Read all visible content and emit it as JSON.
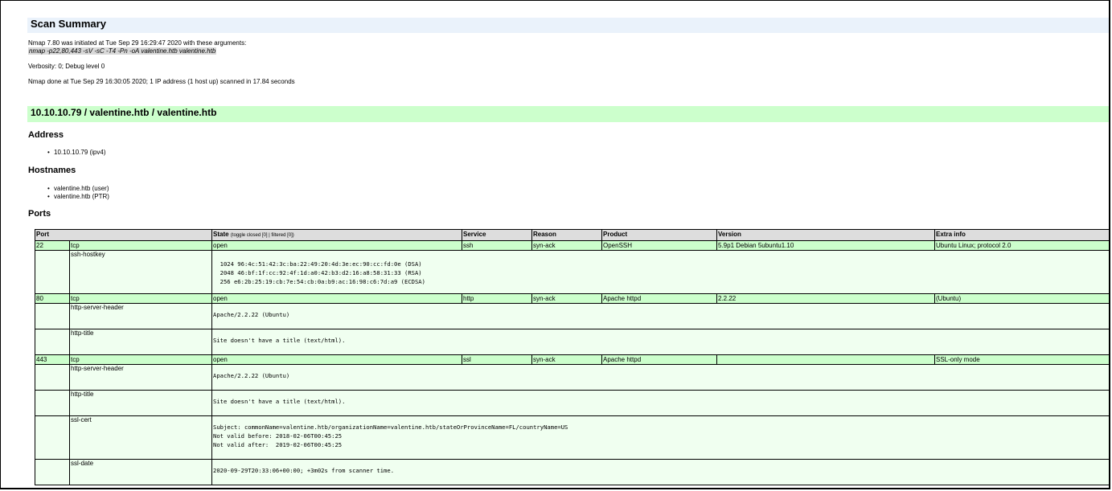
{
  "summary": {
    "title": "Scan Summary",
    "initiated": "Nmap 7.80 was initiated at Tue Sep 29 16:29:47 2020 with these arguments:",
    "args": "nmap -p22,80,443 -sV -sC -T4 -Pn -oA valentine.htb valentine.htb",
    "verbosity": "Verbosity: 0; Debug level 0",
    "done": "Nmap done at Tue Sep 29 16:30:05 2020; 1 IP address (1 host up) scanned in 17.84 seconds"
  },
  "host": {
    "title": "10.10.10.79 / valentine.htb / valentine.htb",
    "address_heading": "Address",
    "address": "10.10.10.79 (ipv4)",
    "hostnames_heading": "Hostnames",
    "hostnames": [
      "valentine.htb (user)",
      "valentine.htb (PTR)"
    ],
    "ports_heading": "Ports"
  },
  "table": {
    "headers": {
      "port": "Port",
      "state": "State",
      "toggle_closed": "(toggle closed [0]",
      "sep": " | ",
      "toggle_filtered": "filtered [0])",
      "service": "Service",
      "reason": "Reason",
      "product": "Product",
      "version": "Version",
      "extra": "Extra info"
    },
    "ports": [
      {
        "port": "22",
        "proto": "tcp",
        "state": "open",
        "service": "ssh",
        "reason": "syn-ack",
        "product": "OpenSSH",
        "version": "5.9p1 Debian 5ubuntu1.10",
        "extra": "Ubuntu Linux; protocol 2.0",
        "scripts": [
          {
            "name": "ssh-hostkey",
            "output": "\n  1024 96:4c:51:42:3c:ba:22:49:20:4d:3e:ec:90:cc:fd:0e (DSA)\n  2048 46:bf:1f:cc:92:4f:1d:a0:42:b3:d2:16:a8:58:31:33 (RSA)\n  256 e6:2b:25:19:cb:7e:54:cb:0a:b9:ac:16:98:c6:7d:a9 (ECDSA)"
          }
        ]
      },
      {
        "port": "80",
        "proto": "tcp",
        "state": "open",
        "service": "http",
        "reason": "syn-ack",
        "product": "Apache httpd",
        "version": "2.2.22",
        "extra": "(Ubuntu)",
        "scripts": [
          {
            "name": "http-server-header",
            "output": "Apache/2.2.22 (Ubuntu)"
          },
          {
            "name": "http-title",
            "output": "Site doesn't have a title (text/html)."
          }
        ]
      },
      {
        "port": "443",
        "proto": "tcp",
        "state": "open",
        "service": "ssl",
        "reason": "syn-ack",
        "product": "Apache httpd",
        "version": "",
        "extra": "SSL-only mode",
        "scripts": [
          {
            "name": "http-server-header",
            "output": "Apache/2.2.22 (Ubuntu)"
          },
          {
            "name": "http-title",
            "output": "Site doesn't have a title (text/html)."
          },
          {
            "name": "ssl-cert",
            "output": "Subject: commonName=valentine.htb/organizationName=valentine.htb/stateOrProvinceName=FL/countryName=US\nNot valid before: 2018-02-06T00:45:25\nNot valid after:  2019-02-06T00:45:25"
          },
          {
            "name": "ssl-date",
            "output": "2020-09-29T20:33:06+00:00; +3m02s from scanner time."
          }
        ]
      }
    ]
  },
  "colors": {
    "summary_bg": "#eaf2fb",
    "host_bg": "#ccffcc",
    "port_row_bg": "#ccffcc",
    "script_row_bg": "#f0fff0",
    "header_bg": "#dddddd"
  }
}
